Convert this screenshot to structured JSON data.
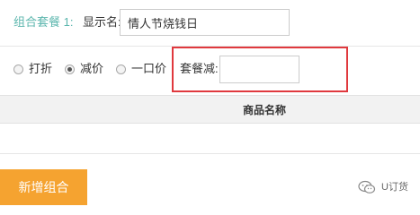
{
  "combo": {
    "label": "组合套餐 1:",
    "label_color": "#5bb6ad",
    "display_name_label": "显示名:",
    "display_name_value": "情人节烧钱日"
  },
  "pricing": {
    "options": [
      {
        "label": "打折",
        "checked": false
      },
      {
        "label": "减价",
        "checked": true
      },
      {
        "label": "一口价",
        "checked": false
      }
    ],
    "reduce_label": "套餐减:",
    "reduce_value": "",
    "highlight_color": "#e0393e"
  },
  "table": {
    "columns": [
      "商品名称"
    ]
  },
  "actions": {
    "add_combo_label": "新增组合",
    "button_color": "#f5a330"
  },
  "watermark": {
    "text": "U订货",
    "icon": "wechat-icon"
  }
}
